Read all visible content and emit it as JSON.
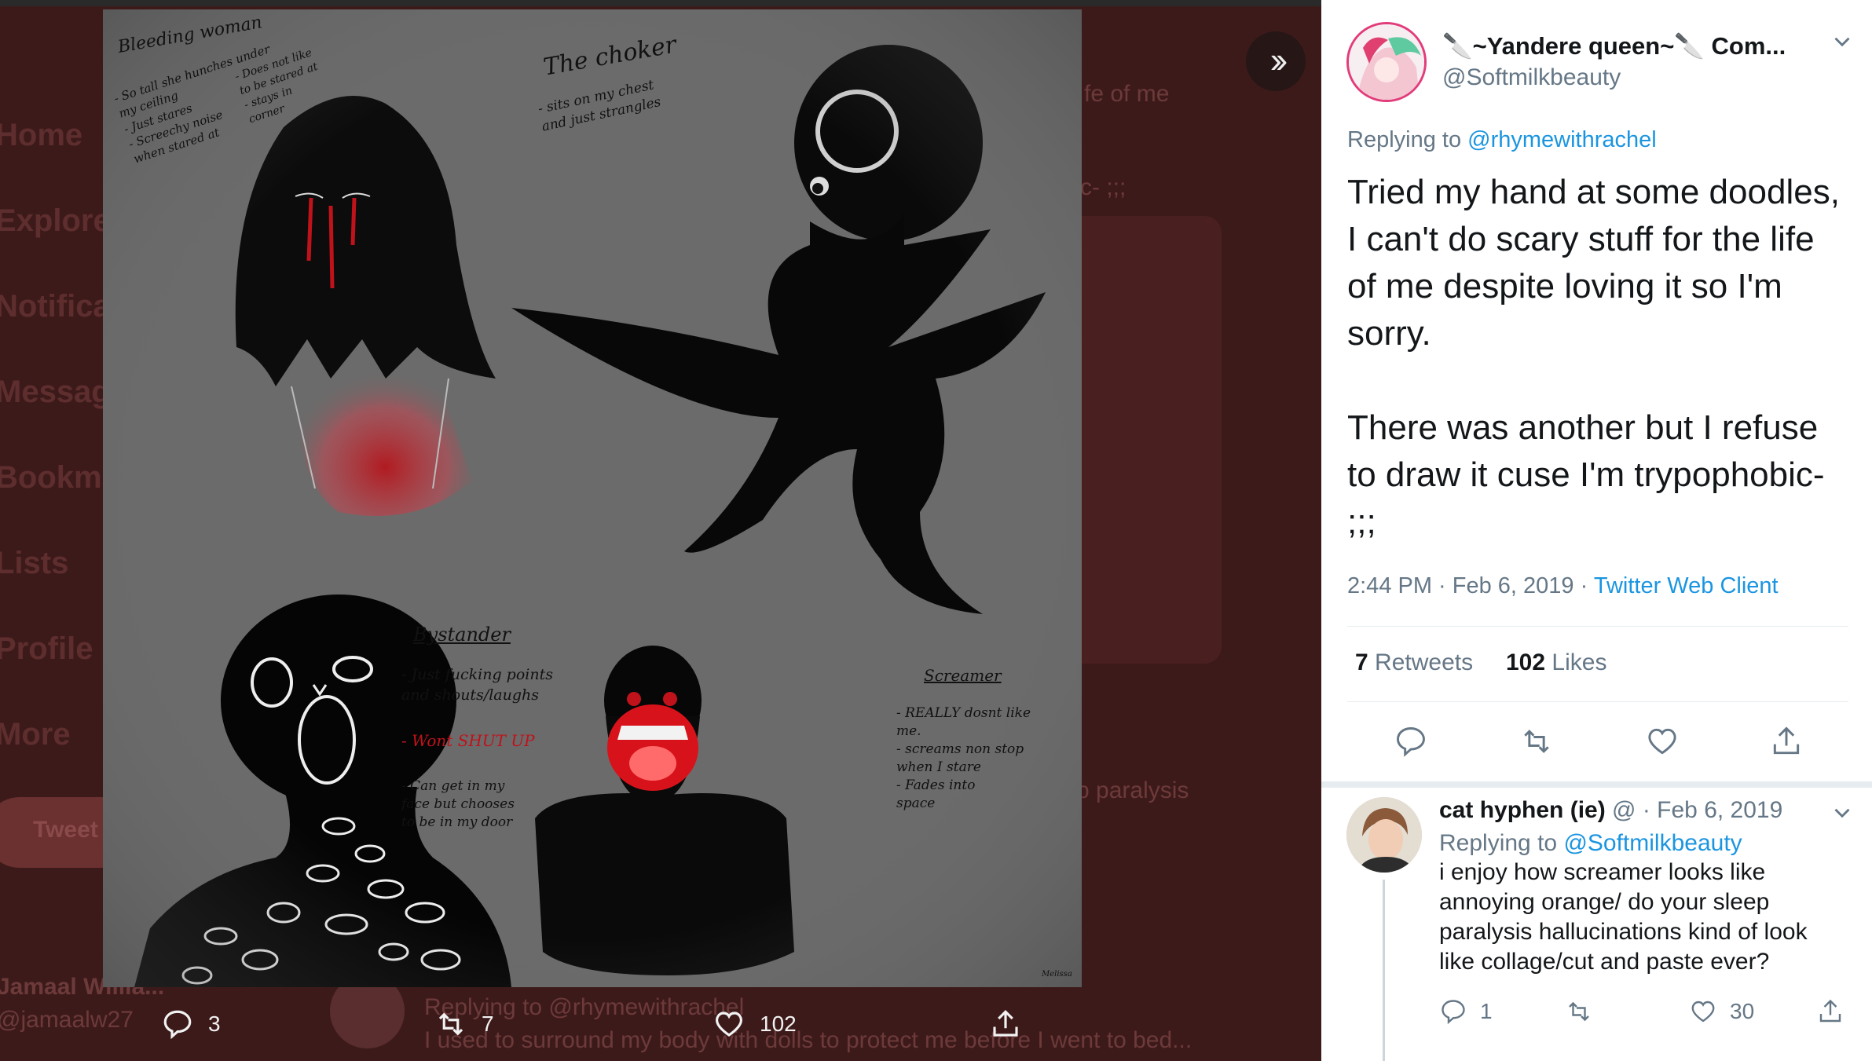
{
  "backdrop": {
    "sidebar": [
      "Home",
      "Explore",
      "Notifica",
      "Messag",
      "Bookma",
      "Lists",
      "Profile",
      "More"
    ],
    "tweet_button": "Tweet",
    "bits": {
      "life_of_me": "fe of me",
      "semicolons": "c- ;;;",
      "paralysis": "p paralysis",
      "replier_name": "Jamaal Willia...",
      "replier_handle": "@jamaalw27",
      "replying": "Replying to @rhymewithrachel",
      "snippet": "I used to surround my body with dolls to protect me before I went to bed..."
    }
  },
  "image": {
    "alt": "Horror doodles sketch sheet",
    "notes": {
      "bleeding_title": "Bleeding woman",
      "bleeding_list": "- So tall she hunches under\n  my ceiling\n- Just stares\n- Screechy noise\n  when stared at",
      "bleeding_side": "- Does not like\n  to be stared at\n- stays in\n  corner",
      "choker_title": "The choker",
      "choker_list": "- sits on my chest\n  and just strangles",
      "bystander_title": "Bystander",
      "bystander_list": "- Just fucking points\n  and shouts/laughs",
      "bystander_red": "- Wont SHUT UP",
      "bystander_list2": "- Can get in my\n  face but chooses\n  to be in my door",
      "screamer_title": "Screamer",
      "screamer_list": "- REALLY dosnt like\n  me.\n- screams non stop\n  when I stare\n- Fades into\n  space",
      "signature": "Melissa"
    }
  },
  "image_actions": {
    "reply_count": "3",
    "retweet_count": "7",
    "like_count": "102"
  },
  "tweet": {
    "display_name": "🔪~Yandere queen~🔪 Com...",
    "handle": "@Softmilkbeauty",
    "replying_prefix": "Replying to",
    "replying_to": "@rhymewithrachel",
    "text": "Tried my hand at some doodles, I can't do scary stuff for the life of me despite loving it so I'm sorry.\n\nThere was another but I refuse to draw it cuse I'm trypophobic-\n;;;",
    "time": "2:44 PM · Feb 6, 2019 ·",
    "client": "Twitter Web Client",
    "retweets_count": "7",
    "retweets_label": "Retweets",
    "likes_count": "102",
    "likes_label": "Likes"
  },
  "reply": {
    "display_name": "cat hyphen (ie)",
    "handle_date": "@ · Feb 6, 2019",
    "replying_prefix": "Replying to",
    "replying_to": "@Softmilkbeauty",
    "text": "i enjoy how screamer looks like annoying orange/ do your sleep paralysis hallucinations kind of look like collage/cut and paste ever?",
    "reply_count": "1",
    "retweet_count": "",
    "like_count": "30"
  },
  "colors": {
    "link": "#1b95e0",
    "muted": "#657786",
    "blood": "#c0121a",
    "overlay": "#3d1a1a"
  },
  "icons": [
    "chevron-right-double-icon",
    "reply-icon",
    "retweet-icon",
    "like-icon",
    "share-icon",
    "chevron-down-icon"
  ]
}
